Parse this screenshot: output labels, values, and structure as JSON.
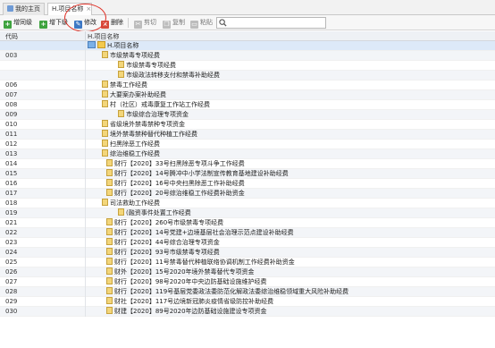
{
  "tabs": [
    {
      "label": "我的主页"
    },
    {
      "label": "H.项目名称",
      "close": "×"
    }
  ],
  "toolbar": {
    "add_sibling": "增同级",
    "add_child": "增下级",
    "edit": "修改",
    "delete": "删除",
    "cut": "剪切",
    "copy": "复制",
    "paste": "粘贴",
    "search_value": ""
  },
  "columns": {
    "code": "代码",
    "name": "H.项目名称"
  },
  "root": "H.项目名称",
  "rows": [
    {
      "code": "003",
      "name": "市级禁毒专项经费",
      "level": 1
    },
    {
      "code": "",
      "name": "市级禁毒专项经费",
      "level": 2
    },
    {
      "code": "",
      "name": "市级政法转移支付和禁毒补助经费",
      "level": 2
    },
    {
      "code": "006",
      "name": "禁毒工作经费",
      "level": 1
    },
    {
      "code": "007",
      "name": "大要案办案补助经费",
      "level": 1
    },
    {
      "code": "008",
      "name": "村（社区）戒毒康复工作站工作经费",
      "level": 1
    },
    {
      "code": "009",
      "name": "市级综合治理专项资金",
      "level": 2
    },
    {
      "code": "010",
      "name": "省级境外禁毒禁种专项资金",
      "level": 1
    },
    {
      "code": "011",
      "name": "境外禁毒禁种替代种植工作经费",
      "level": 1
    },
    {
      "code": "012",
      "name": "扫黑除恶工作经费",
      "level": 1
    },
    {
      "code": "013",
      "name": "综治维稳工作经费",
      "level": 1
    },
    {
      "code": "014",
      "name": "财行【2020】33号扫黑除恶专项斗争工作经费",
      "level": 3
    },
    {
      "code": "015",
      "name": "财行【2020】14号腾冲中小学法制宣传教育基地建设补助经费",
      "level": 3
    },
    {
      "code": "016",
      "name": "财行【2020】16号中央扫黑除恶工作补助经费",
      "level": 3
    },
    {
      "code": "017",
      "name": "财行【2020】20号综治维稳工作经费补助资金",
      "level": 3
    },
    {
      "code": "018",
      "name": "司法救助工作经费",
      "level": 1
    },
    {
      "code": "019",
      "name": "(融资事件处置工作经费",
      "level": 2
    },
    {
      "code": "021",
      "name": "财行【2020】260号市级禁毒专项经费",
      "level": 3
    },
    {
      "code": "022",
      "name": "财行【2020】14号党建+边境基层社会治理示范点建设补助经费",
      "level": 3
    },
    {
      "code": "023",
      "name": "财行【2020】44号综合治理专项资金",
      "level": 3
    },
    {
      "code": "024",
      "name": "财行【2020】93号市级禁毒专项经费",
      "level": 3
    },
    {
      "code": "025",
      "name": "财行【2020】11号禁毒替代种植联络协调机制工作经费补助资金",
      "level": 3
    },
    {
      "code": "026",
      "name": "财外【2020】15号2020年境外禁毒替代专项资金",
      "level": 3
    },
    {
      "code": "027",
      "name": "财行【2020】98号2020年中央边防基础设施维护经费",
      "level": 3
    },
    {
      "code": "028",
      "name": "财行【2020】119号基层党委政法委防范化解政法委综治维稳领域重大风险补助经费",
      "level": 3
    },
    {
      "code": "029",
      "name": "财社【2020】117号边境新冠肺炎疫情省级防控补助经费",
      "level": 3
    },
    {
      "code": "030",
      "name": "财建【2020】89号2020年边防基础设施建设专项资金",
      "level": 3
    }
  ]
}
